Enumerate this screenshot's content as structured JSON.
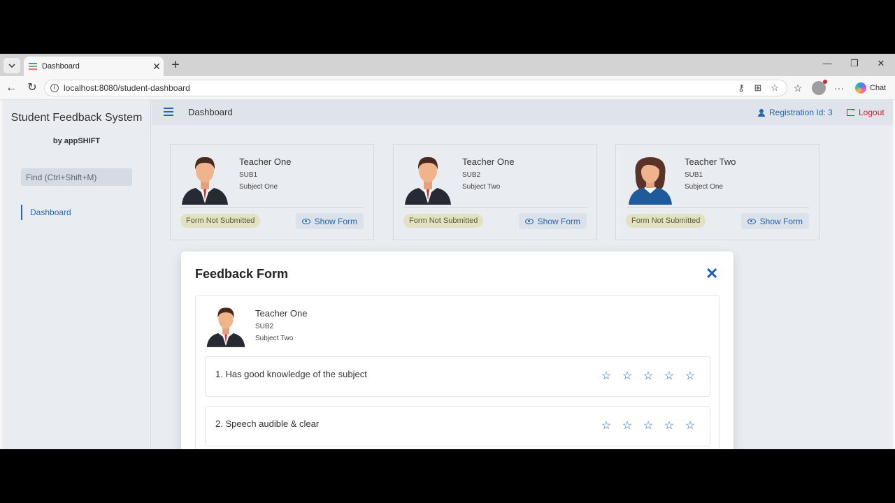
{
  "browser": {
    "tab_title": "Dashboard",
    "url": "localhost:8080/student-dashboard",
    "chat_label": "Chat"
  },
  "sidebar": {
    "title": "Student Feedback System",
    "subtitle": "by appSHIFT",
    "search_placeholder": "Find (Ctrl+Shift+M)",
    "nav_item": "Dashboard"
  },
  "topbar": {
    "page_title": "Dashboard",
    "registration": "Registration Id: 3",
    "logout": "Logout"
  },
  "cards": [
    {
      "name": "Teacher One",
      "code": "SUB1",
      "subject": "Subject One",
      "status": "Form Not Submitted",
      "button": "Show Form",
      "avatar": "male"
    },
    {
      "name": "Teacher One",
      "code": "SUB2",
      "subject": "Subject Two",
      "status": "Form Not Submitted",
      "button": "Show Form",
      "avatar": "male"
    },
    {
      "name": "Teacher Two",
      "code": "SUB1",
      "subject": "Subject One",
      "status": "Form Not Submitted",
      "button": "Show Form",
      "avatar": "female"
    }
  ],
  "modal": {
    "title": "Feedback Form",
    "close_symbol": "✕",
    "teacher": {
      "name": "Teacher One",
      "code": "SUB2",
      "subject": "Subject Two"
    },
    "questions": [
      {
        "text": "1. Has good knowledge of the subject",
        "rating": 0,
        "max": 5
      },
      {
        "text": "2. Speech audible & clear",
        "rating": 0,
        "max": 5
      }
    ]
  },
  "colors": {
    "accent": "#2365b8",
    "logout": "#c0282e",
    "badge_bg": "#e2e2c3"
  }
}
